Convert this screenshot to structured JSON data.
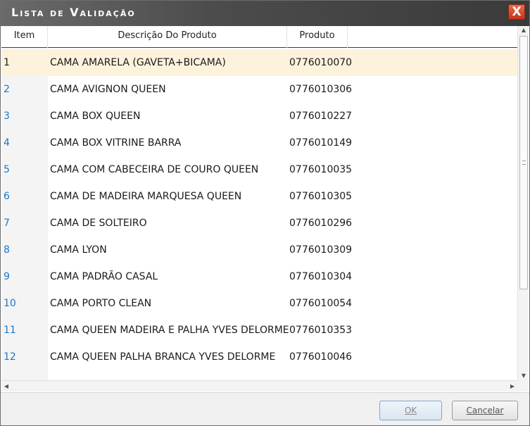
{
  "window": {
    "title": "Lista de Validação",
    "close_label": "X"
  },
  "table": {
    "columns": [
      "Item",
      "Descrição Do Produto",
      "Produto"
    ],
    "rows": [
      {
        "item": "1",
        "desc": "CAMA AMARELA (GAVETA+BICAMA)",
        "prod": "0776010070",
        "selected": true
      },
      {
        "item": "2",
        "desc": "CAMA AVIGNON QUEEN",
        "prod": "0776010306"
      },
      {
        "item": "3",
        "desc": "CAMA BOX QUEEN",
        "prod": "0776010227"
      },
      {
        "item": "4",
        "desc": "CAMA BOX VITRINE BARRA",
        "prod": "0776010149"
      },
      {
        "item": "5",
        "desc": "CAMA COM CABECEIRA DE COURO QUEEN",
        "prod": "0776010035"
      },
      {
        "item": "6",
        "desc": "CAMA DE MADEIRA MARQUESA QUEEN",
        "prod": "0776010305"
      },
      {
        "item": "7",
        "desc": "CAMA DE SOLTEIRO",
        "prod": "0776010296"
      },
      {
        "item": "8",
        "desc": "CAMA LYON",
        "prod": "0776010309"
      },
      {
        "item": "9",
        "desc": "CAMA PADRÃO CASAL",
        "prod": "0776010304"
      },
      {
        "item": "10",
        "desc": "CAMA PORTO CLEAN",
        "prod": "0776010054"
      },
      {
        "item": "11",
        "desc": "CAMA QUEEN  MADEIRA E PALHA YVES DELORME",
        "prod": "0776010353"
      },
      {
        "item": "12",
        "desc": "CAMA QUEEN PALHA BRANCA YVES DELORME",
        "prod": "0776010046"
      }
    ]
  },
  "footer": {
    "ok_label": "OK",
    "cancel_label": "Cancelar"
  },
  "icons": {
    "close": "close-icon",
    "scroll_up": "arrow-up-icon",
    "scroll_down": "arrow-down-icon",
    "scroll_left": "arrow-left-icon",
    "scroll_right": "arrow-right-icon"
  },
  "colors": {
    "titlebar": "#4c4c4c",
    "close": "#d44a2e",
    "selected_row": "#fdf3dc",
    "item_link": "#1a78c8"
  }
}
